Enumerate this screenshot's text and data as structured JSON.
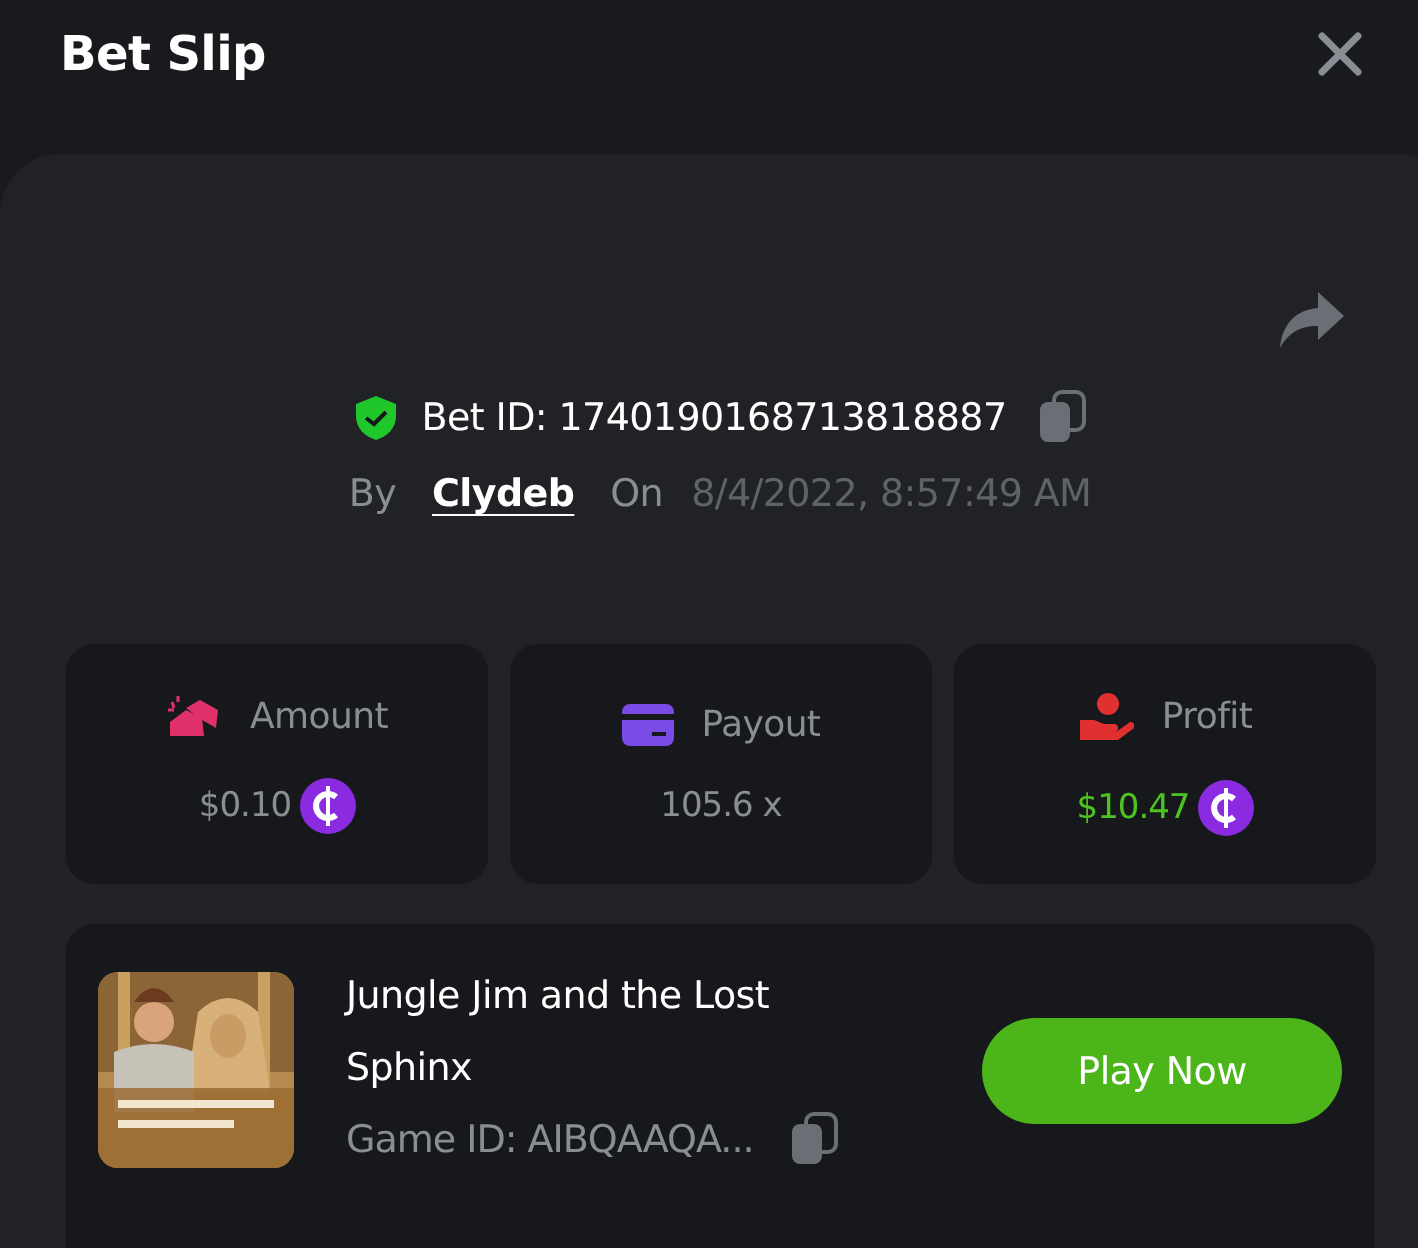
{
  "title": "Bet Slip",
  "bet": {
    "id_label": "Bet ID: 1740190168713818887",
    "verified": true,
    "by_label": "By",
    "user": "Clydeb",
    "on_label": "On",
    "date": "8/4/2022, 8:57:49 AM"
  },
  "stats": [
    {
      "kind": "amount",
      "label": "Amount",
      "value": "$0.10",
      "coin": true,
      "positive": false
    },
    {
      "kind": "payout",
      "label": "Payout",
      "value": "105.6 x",
      "coin": false,
      "positive": false
    },
    {
      "kind": "profit",
      "label": "Profit",
      "value": "$10.47",
      "coin": true,
      "positive": true
    }
  ],
  "game": {
    "name": "Jungle Jim and the Lost Sphinx",
    "id": "Game ID: AIBQAAQA...",
    "button": "Play Now"
  }
}
